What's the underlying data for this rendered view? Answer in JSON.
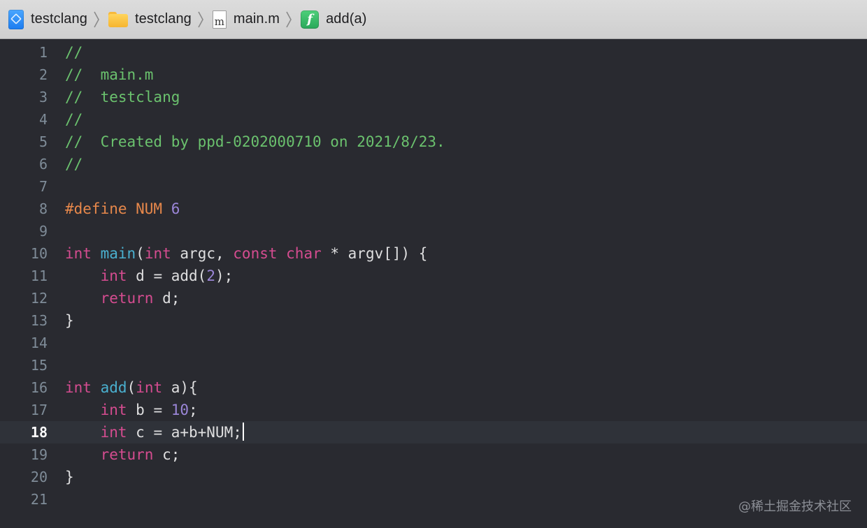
{
  "breadcrumb": [
    {
      "label": "testclang",
      "icon": "xcode-project-icon"
    },
    {
      "label": "testclang",
      "icon": "folder-icon"
    },
    {
      "label": "main.m",
      "icon": "objc-file-icon",
      "icon_glyph": "m"
    },
    {
      "label": "add(a)",
      "icon": "function-icon",
      "icon_glyph": "f"
    }
  ],
  "editor": {
    "current_line": 18,
    "lines": [
      {
        "n": "1",
        "text": "//"
      },
      {
        "n": "2",
        "text": "//  main.m"
      },
      {
        "n": "3",
        "text": "//  testclang"
      },
      {
        "n": "4",
        "text": "//"
      },
      {
        "n": "5",
        "text": "//  Created by ppd-0202000710 on 2021/8/23."
      },
      {
        "n": "6",
        "text": "//"
      },
      {
        "n": "7",
        "text": ""
      },
      {
        "n": "8",
        "text": "#define NUM 6"
      },
      {
        "n": "9",
        "text": ""
      },
      {
        "n": "10",
        "text": "int main(int argc, const char * argv[]) {"
      },
      {
        "n": "11",
        "text": "    int d = add(2);"
      },
      {
        "n": "12",
        "text": "    return d;"
      },
      {
        "n": "13",
        "text": "}"
      },
      {
        "n": "14",
        "text": ""
      },
      {
        "n": "15",
        "text": ""
      },
      {
        "n": "16",
        "text": "int add(int a){"
      },
      {
        "n": "17",
        "text": "    int b = 10;"
      },
      {
        "n": "18",
        "text": "    int c = a+b+NUM;"
      },
      {
        "n": "19",
        "text": "    return c;"
      },
      {
        "n": "20",
        "text": "}"
      },
      {
        "n": "21",
        "text": ""
      }
    ]
  },
  "watermark": "@稀土掘金技术社区",
  "colors": {
    "editor_background": "#292a30",
    "comment": "#6bc26e",
    "keyword": "#d54c90",
    "function": "#4ab0cf",
    "number": "#9b86d8",
    "preprocessor": "#e7884b",
    "plain_text": "#dfdfe0"
  }
}
